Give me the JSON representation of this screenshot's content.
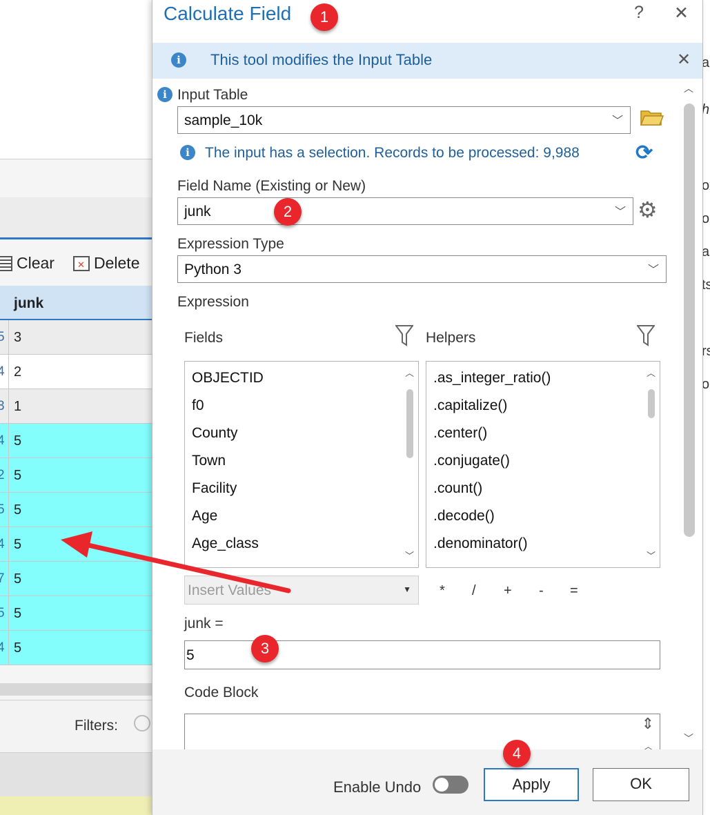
{
  "background_table": {
    "toolbar": {
      "clear_label": "Clear",
      "delete_label": "Delete"
    },
    "column_header": "junk",
    "rows": [
      {
        "id_fragment": "5",
        "value": "3",
        "style": "grey"
      },
      {
        "id_fragment": "4",
        "value": "2",
        "style": "white"
      },
      {
        "id_fragment": "3",
        "value": "1",
        "style": "grey"
      },
      {
        "id_fragment": "4",
        "value": "5",
        "style": "cyan"
      },
      {
        "id_fragment": "2",
        "value": "5",
        "style": "cyan"
      },
      {
        "id_fragment": "5",
        "value": "5",
        "style": "cyan"
      },
      {
        "id_fragment": "4",
        "value": "5",
        "style": "cyan"
      },
      {
        "id_fragment": "7",
        "value": "5",
        "style": "cyan"
      },
      {
        "id_fragment": "5",
        "value": "5",
        "style": "cyan"
      },
      {
        "id_fragment": "4",
        "value": "5",
        "style": "cyan"
      }
    ],
    "filters_label": "Filters:",
    "selection_color": "#84fdfd"
  },
  "right_edge_fragments": [
    "al",
    "h",
    "ox",
    "oc",
    "as",
    "ts",
    "rs",
    "or"
  ],
  "dialog": {
    "title": "Calculate Field",
    "help_label": "?",
    "close_label": "✕",
    "banner": {
      "text": "This tool modifies the Input Table",
      "close_label": "✕"
    },
    "input_table": {
      "label": "Input Table",
      "value": "sample_10k"
    },
    "selection_message": "The input has a selection. Records to be processed: 9,988",
    "field_name": {
      "label": "Field Name (Existing or New)",
      "value": "junk"
    },
    "expression_type": {
      "label": "Expression Type",
      "value": "Python 3"
    },
    "expression_label": "Expression",
    "fields": {
      "label": "Fields",
      "items": [
        "OBJECTID",
        "f0",
        "County",
        "Town",
        "Facility",
        "Age",
        "Age_class"
      ]
    },
    "helpers": {
      "label": "Helpers",
      "items": [
        ".as_integer_ratio()",
        ".capitalize()",
        ".center()",
        ".conjugate()",
        ".count()",
        ".decode()",
        ".denominator()"
      ]
    },
    "insert_values": {
      "placeholder": "Insert Values"
    },
    "operators": [
      "*",
      "/",
      "+",
      "-",
      "="
    ],
    "expression": {
      "label": "junk =",
      "value": "5"
    },
    "code_block": {
      "label": "Code Block",
      "value": ""
    },
    "enable_undo": {
      "label": "Enable Undo",
      "on": false
    },
    "apply_label": "Apply",
    "ok_label": "OK"
  },
  "annotations": {
    "badges": [
      "1",
      "2",
      "3",
      "4"
    ],
    "color": "#e8262b"
  },
  "colors": {
    "title_blue": "#1f6fb5",
    "banner_bg": "#deecf9",
    "accent": "#2b78c5"
  }
}
